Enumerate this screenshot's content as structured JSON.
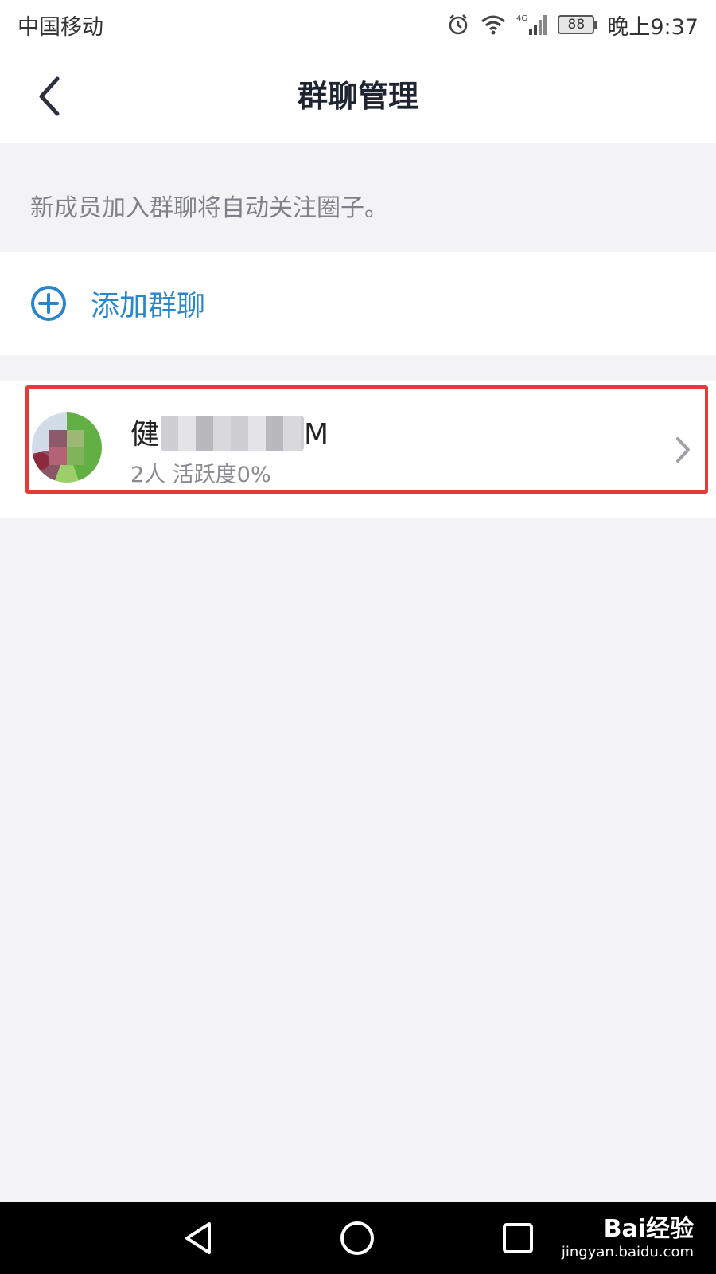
{
  "status_bar": {
    "carrier": "中国移动",
    "network": "4G",
    "battery": "88",
    "time": "晚上9:37",
    "icons": [
      "alarm-icon",
      "wifi-icon",
      "signal-icon",
      "battery-icon"
    ]
  },
  "header": {
    "title": "群聊管理",
    "back_icon": "chevron-left-icon"
  },
  "hint": "新成员加入群聊将自动关注圈子。",
  "add_group": {
    "label": "添加群聊",
    "icon": "plus-circle-icon"
  },
  "group": {
    "name_start": "健",
    "name_end": "M",
    "meta": "2人 活跃度0%",
    "highlight_color": "#e33a3a"
  },
  "system_nav": {
    "buttons": [
      "back-triangle-icon",
      "home-circle-icon",
      "recents-square-icon"
    ]
  },
  "watermark": {
    "brand": "Bai经验",
    "url": "jingyan.baidu.com"
  },
  "colors": {
    "accent": "#2a86c8",
    "background": "#f3f3f6",
    "title": "#1e2430"
  }
}
